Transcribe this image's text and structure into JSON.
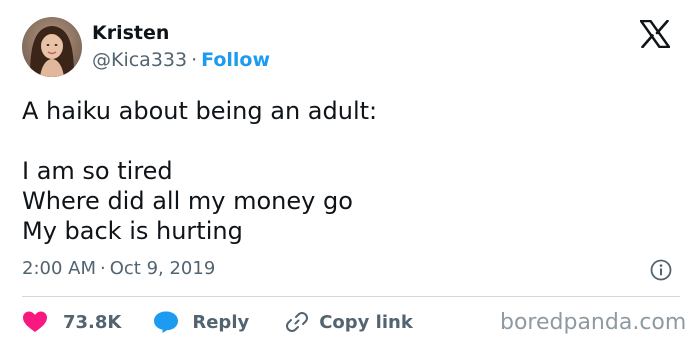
{
  "author": {
    "name": "Kristen",
    "handle": "@Kica333",
    "separator": "·",
    "follow_label": "Follow",
    "avatar": "profile-photo"
  },
  "platform_logo": "x-logo",
  "tweet": {
    "lines": [
      "A haiku about being an adult:",
      "",
      "I am so tired",
      "Where did all my money go",
      "My back is hurting"
    ]
  },
  "meta": {
    "time": "2:00 AM",
    "separator": "·",
    "date": "Oct 9, 2019",
    "info_icon": "info-icon"
  },
  "actions": {
    "likes": "73.8K",
    "reply_label": "Reply",
    "copy_link_label": "Copy link"
  },
  "watermark": "boredpanda.com",
  "colors": {
    "text": "#0f1419",
    "secondary": "#536471",
    "accent": "#1d9bf0",
    "like": "#f91880",
    "divider": "#cfd9de",
    "watermark": "#8e9aa1"
  }
}
